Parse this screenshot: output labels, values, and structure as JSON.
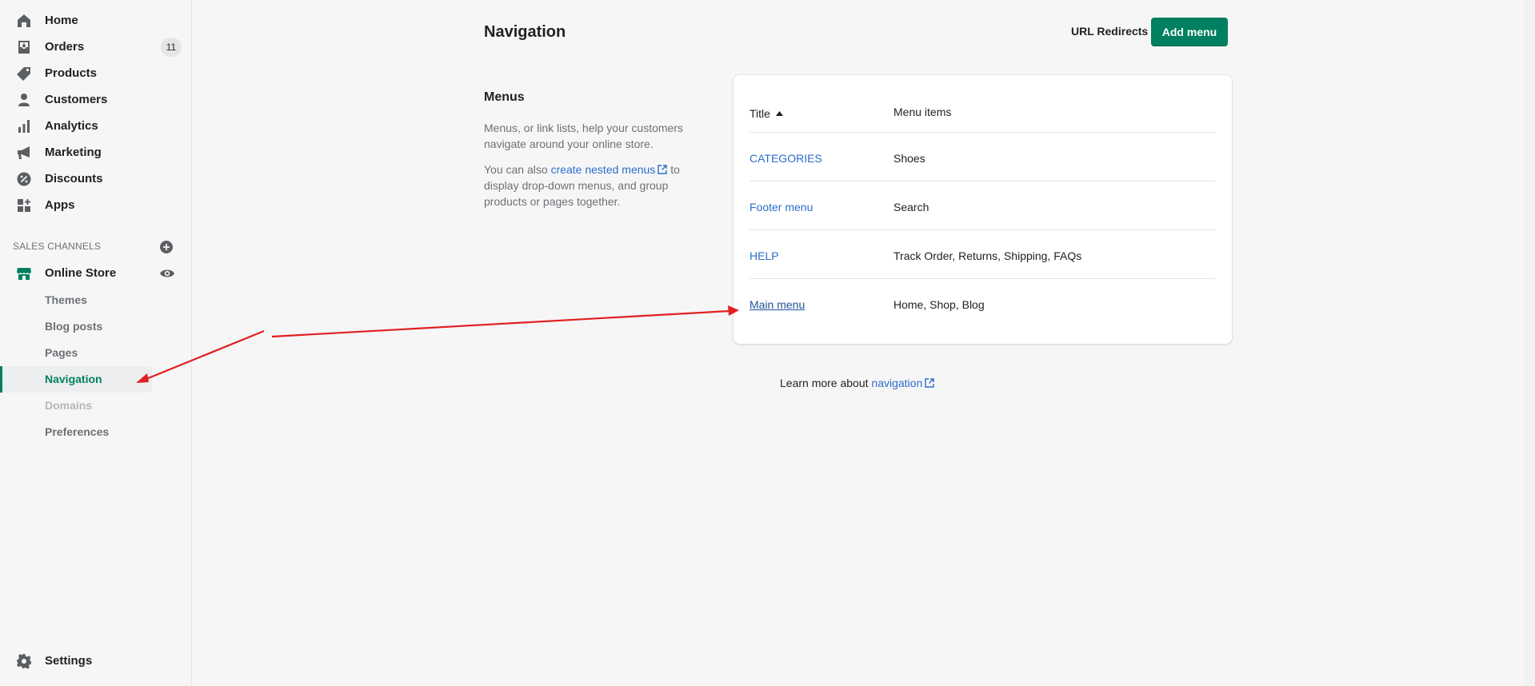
{
  "sidebar": {
    "items": [
      {
        "label": "Home",
        "icon": "home-icon"
      },
      {
        "label": "Orders",
        "icon": "orders-icon",
        "badge": "11"
      },
      {
        "label": "Products",
        "icon": "tag-icon"
      },
      {
        "label": "Customers",
        "icon": "person-icon"
      },
      {
        "label": "Analytics",
        "icon": "bar-chart-icon"
      },
      {
        "label": "Marketing",
        "icon": "megaphone-icon"
      },
      {
        "label": "Discounts",
        "icon": "discount-icon"
      },
      {
        "label": "Apps",
        "icon": "apps-icon"
      }
    ],
    "sales_channels_title": "SALES CHANNELS",
    "online_store": {
      "label": "Online Store",
      "sub_items": [
        {
          "label": "Themes"
        },
        {
          "label": "Blog posts"
        },
        {
          "label": "Pages"
        },
        {
          "label": "Navigation"
        },
        {
          "label": "Domains"
        },
        {
          "label": "Preferences"
        }
      ]
    },
    "settings_label": "Settings"
  },
  "header": {
    "title": "Navigation",
    "url_redirects": "URL Redirects",
    "add_menu": "Add menu"
  },
  "menus_section": {
    "heading": "Menus",
    "description1": "Menus, or link lists, help your customers navigate around your online store.",
    "description2_prefix": "You can also ",
    "description2_link": "create nested menus",
    "description2_suffix": " to display drop-down menus, and group products or pages together."
  },
  "table": {
    "col_title": "Title",
    "col_items": "Menu items",
    "rows": [
      {
        "title": "CATEGORIES",
        "items": "Shoes"
      },
      {
        "title": "Footer menu",
        "items": "Search"
      },
      {
        "title": "HELP",
        "items": "Track Order, Returns, Shipping, FAQs"
      },
      {
        "title": "Main menu",
        "items": "Home, Shop, Blog"
      }
    ]
  },
  "footer": {
    "learn_prefix": "Learn more about ",
    "learn_link": "navigation"
  },
  "colors": {
    "accent": "#008060",
    "link": "#2c6ecb",
    "annotation": "#e02020"
  }
}
